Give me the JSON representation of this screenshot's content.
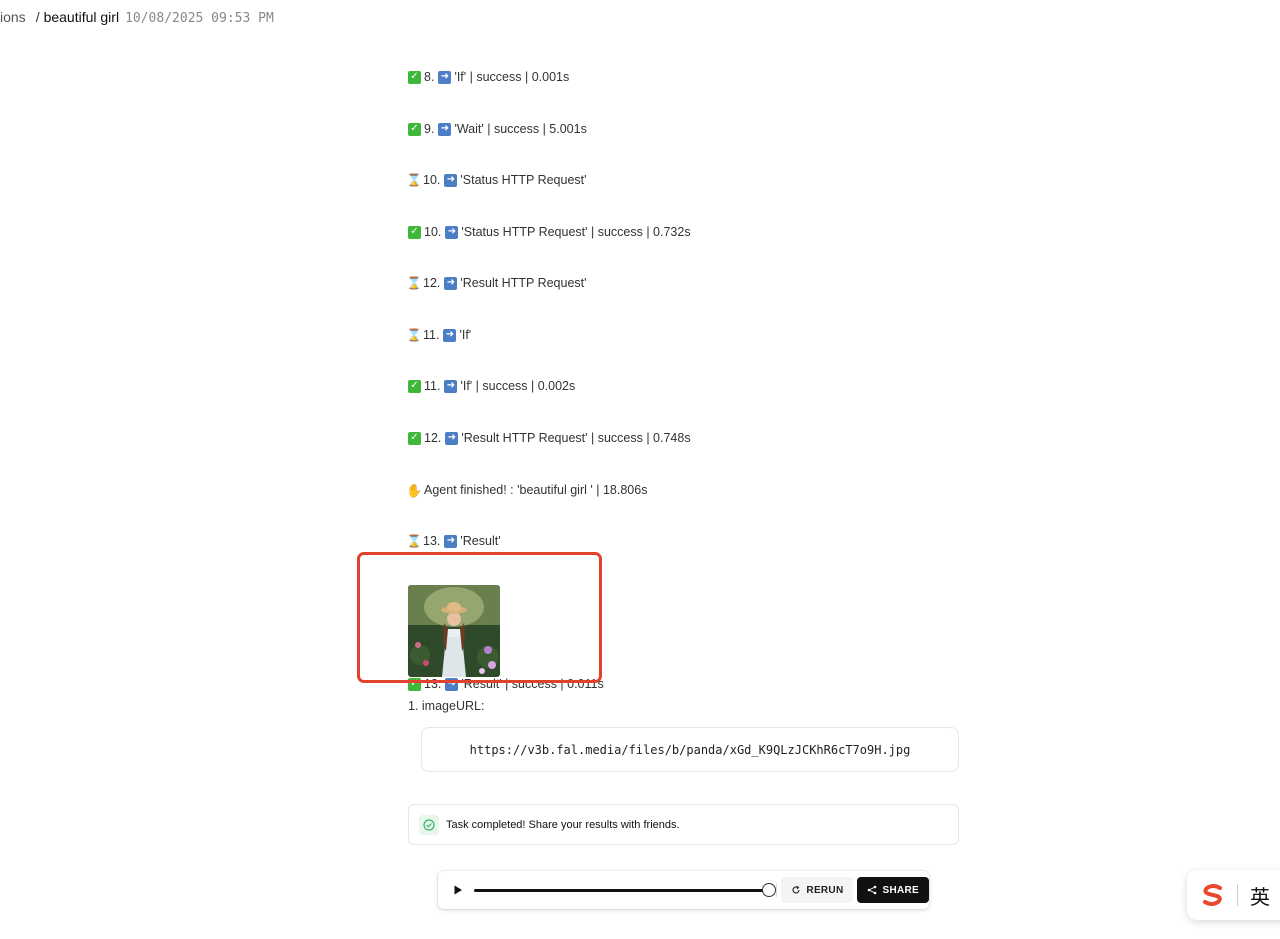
{
  "header": {
    "breadcrumb_parent": "ions",
    "separator": "/",
    "title": "beautiful girl",
    "timestamp": "10/08/2025 09:53 PM"
  },
  "log": {
    "lines": [
      {
        "icon": "check-icon",
        "step": "8.",
        "text": "'If' | success | 0.001s"
      },
      {
        "icon": "check-icon",
        "step": "9.",
        "text": "'Wait' | success | 5.001s"
      },
      {
        "icon": "hourglass-icon",
        "step": "10.",
        "text": "'Status HTTP Request'"
      },
      {
        "icon": "check-icon",
        "step": "10.",
        "text": "'Status HTTP Request' | success | 0.732s"
      },
      {
        "icon": "hourglass-icon",
        "step": "12.",
        "text": "'Result HTTP Request'"
      },
      {
        "icon": "hourglass-icon",
        "step": "11.",
        "text": "'If'"
      },
      {
        "icon": "check-icon",
        "step": "11.",
        "text": "'If' | success | 0.002s"
      },
      {
        "icon": "check-icon",
        "step": "12.",
        "text": "'Result HTTP Request' | success | 0.748s"
      },
      {
        "icon": "wave-icon",
        "step": "",
        "text": "Agent finished! : 'beautiful girl ' | 18.806s"
      },
      {
        "icon": "hourglass-icon",
        "step": "13.",
        "text": "'Result'"
      },
      {
        "icon": "check-icon",
        "step": "13.",
        "text": "'Result' | success | 0.011s"
      }
    ],
    "image_url_label": "1. imageURL:"
  },
  "result": {
    "image_url": "https://v3b.fal.media/files/b/panda/xGd_K9QLzJCKhR6cT7o9H.jpg"
  },
  "toast": {
    "text": "Task completed! Share your results with friends."
  },
  "player": {
    "progress": 1.0,
    "rerun_label": "RERUN",
    "share_label": "SHARE"
  },
  "ime": {
    "lang": "英"
  },
  "colors": {
    "highlight": "#e2412e",
    "check": "#3fb83a",
    "arrow": "#4b7ec4",
    "brand_ime": "#e8482c"
  }
}
